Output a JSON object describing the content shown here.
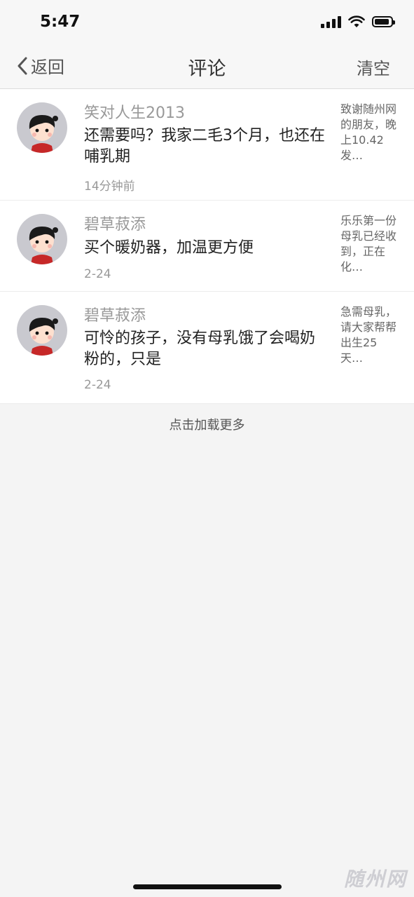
{
  "status_bar": {
    "time": "5:47",
    "icons": [
      "signal-icon",
      "wifi-icon",
      "battery-icon"
    ]
  },
  "nav": {
    "back_label": "返回",
    "title": "评论",
    "clear_label": "清空"
  },
  "comments": [
    {
      "name": "笑对人生2013",
      "content": "还需要吗？我家二毛3个月，也还在哺乳期",
      "time": "14分钟前",
      "source": "致谢随州网的朋友，晚上10.42发…"
    },
    {
      "name": "碧草菽添",
      "content": "买个暖奶器，加温更方便",
      "time": "2-24",
      "source": "乐乐第一份母乳已经收到，正在化…"
    },
    {
      "name": "碧草菽添",
      "content": "可怜的孩子，没有母乳饿了会喝奶粉的，只是",
      "time": "2-24",
      "source": "急需母乳，请大家帮帮出生25天…"
    }
  ],
  "load_more_label": "点击加载更多",
  "watermark": "随州网",
  "colors": {
    "background": "#f4f4f4",
    "name_gray": "#999999",
    "avatar_bg": "#c9c9cf"
  }
}
